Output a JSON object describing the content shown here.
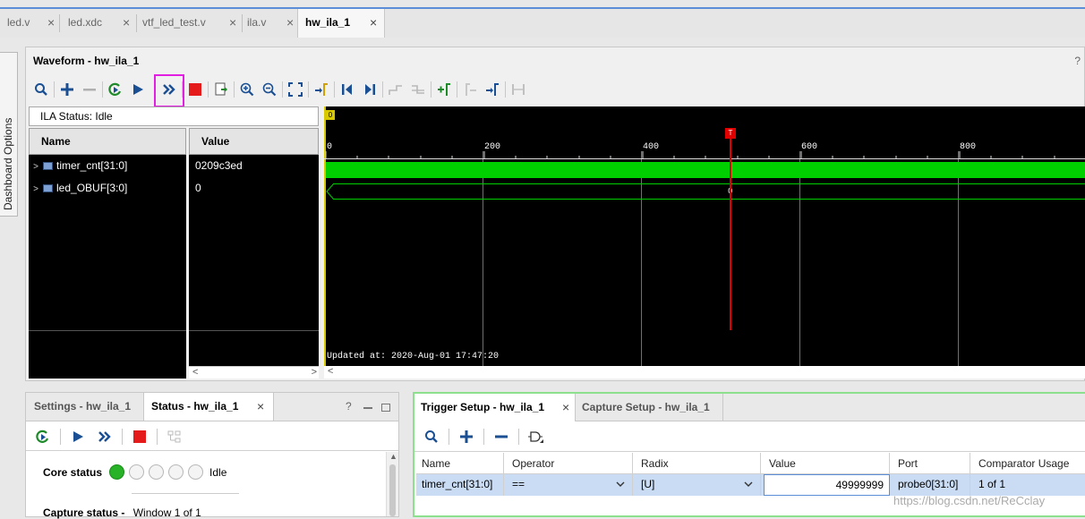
{
  "file_tabs": [
    {
      "label": "led.v"
    },
    {
      "label": "led.xdc"
    },
    {
      "label": "vtf_led_test.v"
    },
    {
      "label": "ila.v"
    },
    {
      "label": "hw_ila_1",
      "active": true
    }
  ],
  "close_glyph": "×",
  "side_tab": {
    "label": "Dashboard Options"
  },
  "waveform": {
    "title": "Waveform - hw_ila_1",
    "help": "?",
    "ila_status": "ILA Status:  Idle",
    "col_name": "Name",
    "col_value": "Value",
    "signals": [
      {
        "name": "timer_cnt[31:0]",
        "value": "0209c3ed"
      },
      {
        "name": "led_OBUF[3:0]",
        "value": "0"
      }
    ],
    "ticks": [
      "0",
      "200",
      "400",
      "600",
      "800"
    ],
    "zero_marker": "0",
    "trigger_marker": "T",
    "bus_label": "0",
    "updated": "Updated at: 2020-Aug-01 17:47:20",
    "scroll_left": "<",
    "scroll_right": ">"
  },
  "bottom_left": {
    "tabs": [
      {
        "label": "Settings - hw_ila_1"
      },
      {
        "label": "Status - hw_ila_1",
        "active": true
      }
    ],
    "help": "?",
    "core_status_label": "Core status",
    "core_status_value": "Idle",
    "capture_status_label": "Capture status -",
    "capture_status_value": "Window 1 of 1"
  },
  "bottom_right": {
    "tabs": [
      {
        "label": "Trigger Setup - hw_ila_1",
        "active": true
      },
      {
        "label": "Capture Setup - hw_ila_1"
      }
    ],
    "columns": [
      "Name",
      "Operator",
      "Radix",
      "Value",
      "Port",
      "Comparator Usage"
    ],
    "row": {
      "name": "timer_cnt[31:0]",
      "operator": "==",
      "radix": "[U]",
      "value": "49999999",
      "port": "probe0[31:0]",
      "comparator_usage": "1 of 1"
    },
    "watermark": "https://blog.csdn.net/ReCclay"
  },
  "icons": {
    "accent": "#1b4f93",
    "play_highlight": "#e21ee2",
    "wave_green": "#00d000",
    "cursor_red": "#e00000"
  }
}
